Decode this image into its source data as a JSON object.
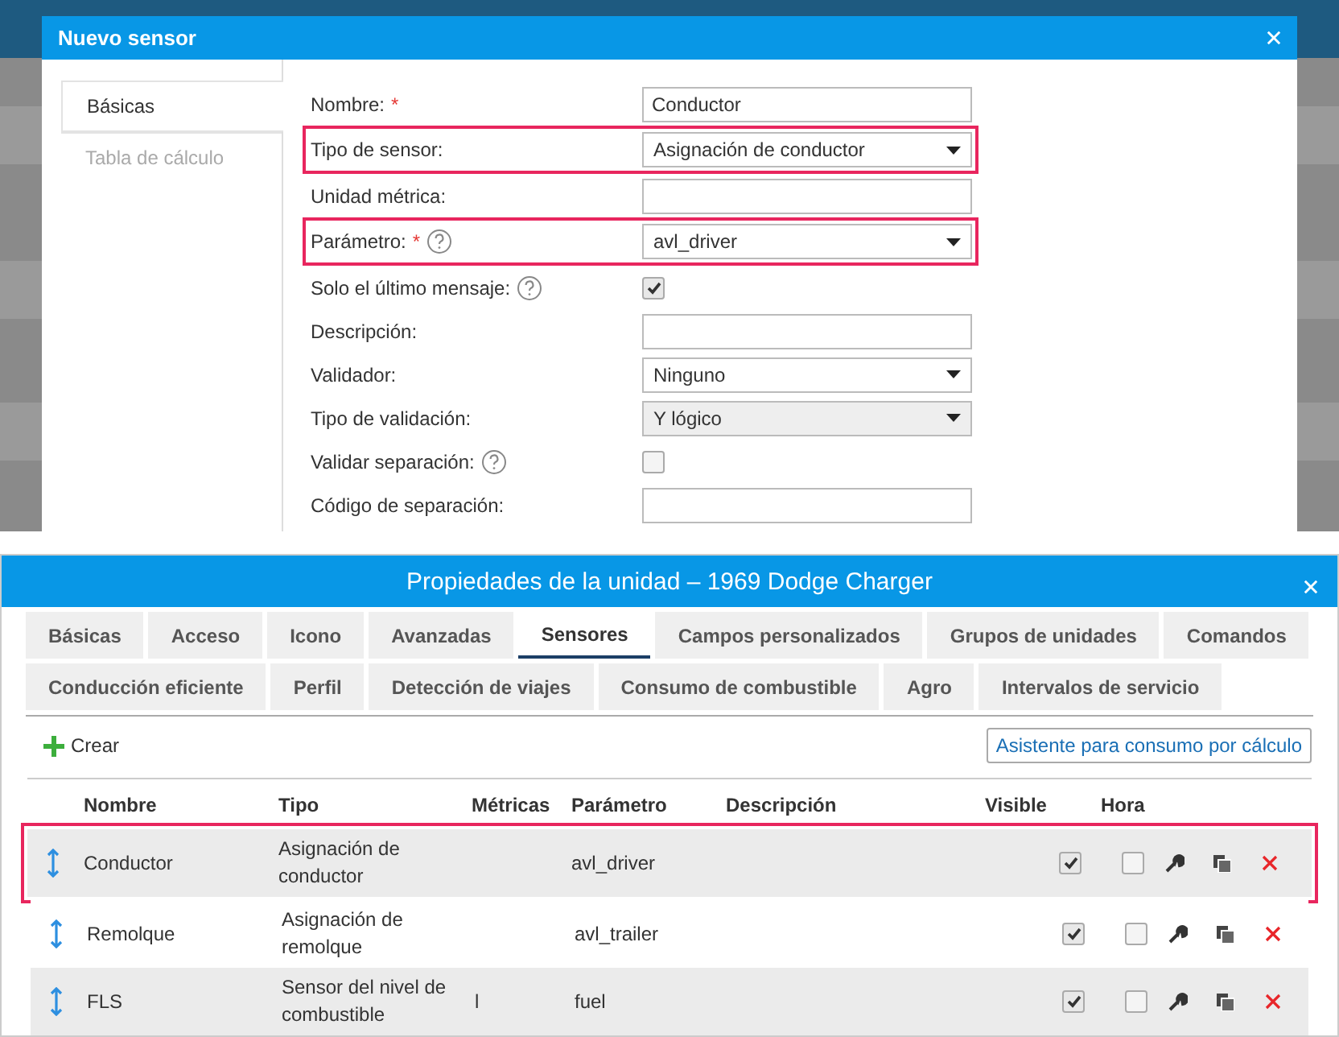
{
  "dialog": {
    "title": "Nuevo sensor",
    "tabs": [
      {
        "label": "Básicas",
        "selected": true
      },
      {
        "label": "Tabla de cálculo",
        "selected": false
      }
    ],
    "fields": [
      {
        "label": "Nombre:",
        "required_mark": "*",
        "help": false,
        "kind": "text",
        "value": "Conductor",
        "disabled": false,
        "highlighted": false
      },
      {
        "label": "Tipo de sensor:",
        "help": false,
        "kind": "select",
        "value": "Asignación de conductor",
        "disabled": false,
        "highlighted": true
      },
      {
        "label": "Unidad métrica:",
        "help": false,
        "kind": "text",
        "disabled": false,
        "highlighted": false
      },
      {
        "label": "Parámetro:",
        "required_mark": "*",
        "help": true,
        "kind": "select",
        "value": "avl_driver",
        "disabled": false,
        "highlighted": true
      },
      {
        "label": "Solo el último mensaje:",
        "help": true,
        "kind": "checkbox",
        "checked": true,
        "disabled": false,
        "highlighted": false
      },
      {
        "label": "Descripción:",
        "help": false,
        "kind": "text",
        "disabled": false,
        "highlighted": false
      },
      {
        "label": "Validador:",
        "help": false,
        "kind": "select",
        "value": "Ninguno",
        "disabled": false,
        "highlighted": false
      },
      {
        "label": "Tipo de validación:",
        "help": false,
        "kind": "select",
        "value": "Y lógico",
        "disabled": true,
        "highlighted": false
      },
      {
        "label": "Validar separación:",
        "help": true,
        "kind": "checkbox",
        "checked": false,
        "disabled": false,
        "highlighted": false
      },
      {
        "label": "Código de separación:",
        "help": false,
        "kind": "text",
        "disabled": false,
        "highlighted": false
      }
    ]
  },
  "window": {
    "title": "Propiedades de la unidad – 1969 Dodge Charger",
    "tab_rows": [
      [
        {
          "label": "Básicas",
          "selected": false
        },
        {
          "label": "Acceso",
          "selected": false
        },
        {
          "label": "Icono",
          "selected": false
        },
        {
          "label": "Avanzadas",
          "selected": false
        },
        {
          "label": "Sensores",
          "selected": true
        },
        {
          "label": "Campos personalizados",
          "selected": false
        },
        {
          "label": "Grupos de unidades",
          "selected": false
        },
        {
          "label": "Comandos",
          "selected": false
        }
      ],
      [
        {
          "label": "Conducción eficiente",
          "selected": false
        },
        {
          "label": "Perfil",
          "selected": false
        },
        {
          "label": "Detección de viajes",
          "selected": false
        },
        {
          "label": "Consumo de combustible",
          "selected": false
        },
        {
          "label": "Agro",
          "selected": false
        },
        {
          "label": "Intervalos de servicio",
          "selected": false
        }
      ]
    ],
    "create_button": "Crear",
    "wizard_button": "Asistente para consumo por cálculo",
    "table": {
      "columns": [
        "Nombre",
        "Tipo",
        "Métricas",
        "Parámetro",
        "Descripción",
        "Visible",
        "Hora"
      ],
      "rows": [
        {
          "name": "Conductor",
          "type": "Asignación de conductor",
          "parameter": "avl_driver",
          "visible": true,
          "time": false,
          "highlighted": true
        },
        {
          "name": "Remolque",
          "type": "Asignación de remolque",
          "parameter": "avl_trailer",
          "visible": true,
          "time": false,
          "highlighted": false
        },
        {
          "name": "FLS",
          "type": "Sensor del nivel de combustible",
          "metrics": "l",
          "parameter": "fuel",
          "visible": true,
          "time": false,
          "highlighted": false
        }
      ]
    }
  }
}
